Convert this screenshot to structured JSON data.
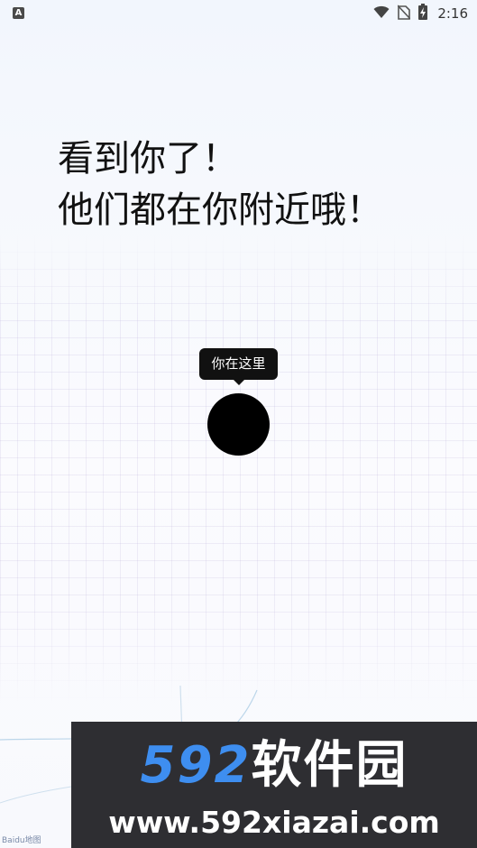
{
  "status_bar": {
    "notification_icon_letter": "A",
    "time": "2:16",
    "icons": [
      "wifi-icon",
      "no-sim-icon",
      "battery-charging-icon"
    ]
  },
  "headline": {
    "line1": "看到你了！",
    "line2": "他们都在你附近哦！"
  },
  "tooltip": {
    "text": "你在这里"
  },
  "location_marker": {
    "color": "#000000"
  },
  "watermark": {
    "brand_number": "592",
    "brand_name": "软件园",
    "url": "www.592xiazai.com",
    "number_color": "#3e8ef0"
  },
  "map_logo": {
    "text": "Baidu地图"
  }
}
